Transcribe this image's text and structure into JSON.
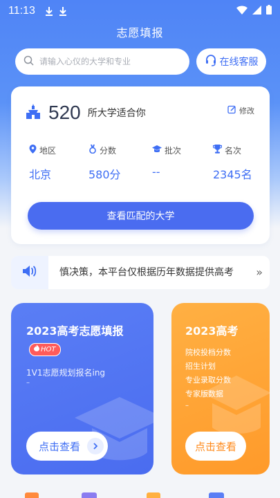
{
  "status_bar": {
    "time": "11:13"
  },
  "header": {
    "title": "志愿填报"
  },
  "search": {
    "placeholder": "请输入心仪的大学和专业"
  },
  "service_button": {
    "label": "在线客服"
  },
  "match_card": {
    "count": "520",
    "count_suffix": "所大学适合你",
    "edit_label": "修改",
    "fields": [
      {
        "icon": "location-pin-icon",
        "label": "地区",
        "value": "北京"
      },
      {
        "icon": "medal-icon",
        "label": "分数",
        "value": "580分"
      },
      {
        "icon": "graduation-cap-icon",
        "label": "批次",
        "value": "--"
      },
      {
        "icon": "trophy-icon",
        "label": "名次",
        "value": "2345名"
      }
    ],
    "button_label": "查看匹配的大学"
  },
  "notice": {
    "text": "慎决策，本平台仅根据历年数据提供高考",
    "more": "»"
  },
  "promo_cards": [
    {
      "title": "2023高考志愿填报",
      "badge": "HOT",
      "subtitle": "1V1志愿规划报名ing",
      "dash": "–",
      "button_label": "点击查看"
    },
    {
      "title": "2023高考",
      "items": [
        "院校投档分数",
        "招生计划",
        "专业录取分数",
        "专家版数据"
      ],
      "dash": "–",
      "button_label": "点击查看"
    }
  ],
  "colors": {
    "accent": "#4a6cf0",
    "orange": "#ff9a2a",
    "hot": "#ff5b5b"
  }
}
